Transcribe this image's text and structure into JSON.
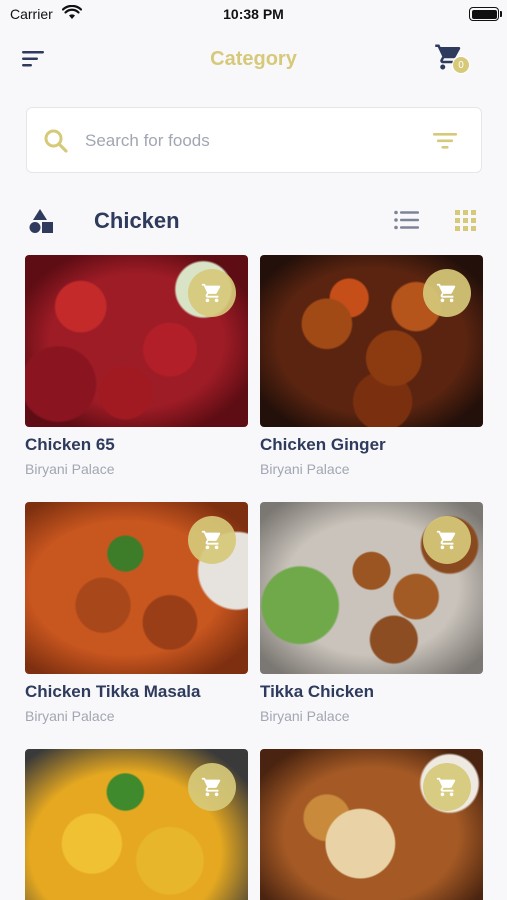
{
  "status_bar": {
    "carrier": "Carrier",
    "time": "10:38 PM"
  },
  "header": {
    "title": "Category",
    "cart_count": "0"
  },
  "search": {
    "placeholder": "Search for foods"
  },
  "section": {
    "title": "Chicken"
  },
  "colors": {
    "accent": "#d6c97a",
    "text": "#2f3b5c",
    "muted": "#a1a6b3",
    "background": "#f8f8fa"
  },
  "products": [
    {
      "name": "Chicken 65",
      "restaurant": "Biryani Palace"
    },
    {
      "name": "Chicken Ginger",
      "restaurant": "Biryani Palace"
    },
    {
      "name": "Chicken Tikka Masala",
      "restaurant": "Biryani Palace"
    },
    {
      "name": "Tikka Chicken",
      "restaurant": "Biryani Palace"
    },
    {
      "name": "",
      "restaurant": ""
    },
    {
      "name": "",
      "restaurant": ""
    }
  ]
}
